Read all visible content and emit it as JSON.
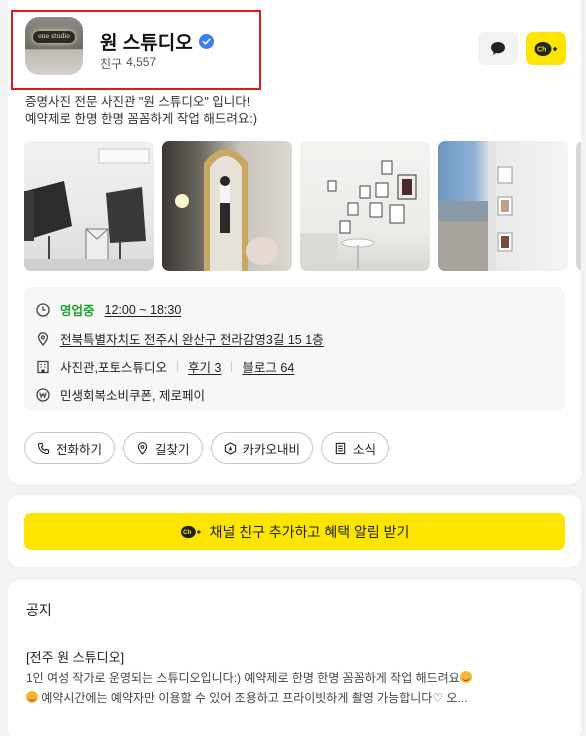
{
  "profile": {
    "avatar_text": "one studio",
    "name": "원 스튜디오",
    "friends_label": "친구",
    "friends_count": "4,557",
    "chat_icon": "chat-bubble-icon",
    "channel_add_label": "Ch+",
    "description_line1": "증명사진 전문 사진관 \"원 스튜디오\" 입니다!",
    "description_line2": "예약제로 한명 한명 꼼꼼하게 작업 해드려요:)"
  },
  "info": {
    "status": "영업중",
    "hours": "12:00 ~ 18:30",
    "address": "전북특별자치도 전주시 완산구 전라감영3길 15 1층",
    "category": "사진관,포토스튜디오",
    "review_label": "후기 3",
    "blog_label": "블로그 64",
    "payment": "민생회복소비쿠폰, 제로페이"
  },
  "actions": [
    {
      "label": "전화하기",
      "icon": "phone-icon"
    },
    {
      "label": "길찾기",
      "icon": "map-pin-icon"
    },
    {
      "label": "카카오내비",
      "icon": "navi-icon"
    },
    {
      "label": "소식",
      "icon": "news-icon"
    }
  ],
  "cta": {
    "label": "채널 친구 추가하고 혜택 알림 받기",
    "icon_label": "Ch+"
  },
  "notice": {
    "title": "공지",
    "subtitle": "[전주 원 스튜디오]",
    "line1": "1인 여성 작가로 운영되는 스튜디오입니다:) 예약제로 한명 한명 꼼꼼하게 작업 해드려요",
    "line2": "예약시간에는 예약자만 이용할 수 있어 조용하고 프라이빗하게 촬영 가능합니다♡ 오..."
  },
  "colors": {
    "kakao_yellow": "#fee500",
    "open_green": "#1fa233",
    "verified_blue": "#3a7ff6",
    "highlight_red": "#e0191a"
  }
}
